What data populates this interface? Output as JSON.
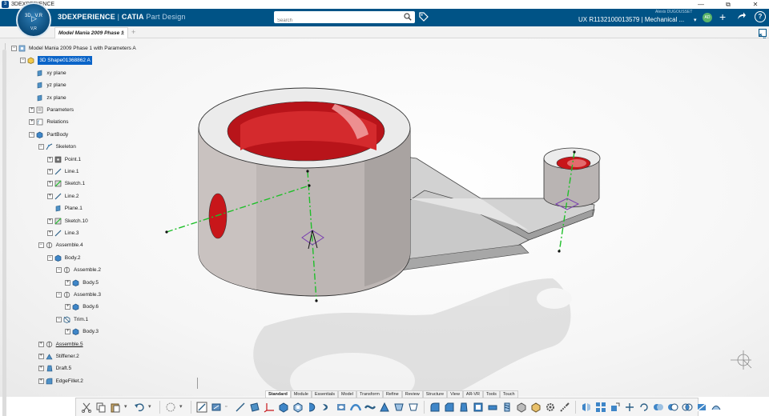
{
  "os": {
    "title": "3DEXPERIENCE",
    "controls": [
      "—",
      "⧉",
      "✕"
    ]
  },
  "app": {
    "compass_labels": {
      "top_left": "3D",
      "top_right": "V.R",
      "bottom": "V,R"
    },
    "brand_main": "3DEXPERIENCE",
    "brand_sep": " | ",
    "brand_app": "CATIA",
    "brand_module": " Part Design",
    "search_placeholder": "Search",
    "user": "Alexis DUGOUSSET",
    "context": "UX R1132100013579 | Mechanical ...",
    "context_caret": "▾",
    "avatar": "AD",
    "plus": "+",
    "help": "?"
  },
  "tabs": {
    "active": "Model Mania 2009 Phase 1",
    "close": "✕",
    "add": "+"
  },
  "tree": [
    {
      "label": "Model Mania 2009 Phase 1 with Parameters A",
      "indent": 0,
      "toggle": "−",
      "icon": "product-icon"
    },
    {
      "label": "3D Shape01368862 A",
      "indent": 1,
      "toggle": "−",
      "icon": "3d-shape-icon",
      "selected": true
    },
    {
      "label": "xy plane",
      "indent": 2,
      "toggle": "",
      "icon": "plane-icon"
    },
    {
      "label": "yz plane",
      "indent": 2,
      "toggle": "",
      "icon": "plane-icon"
    },
    {
      "label": "zx plane",
      "indent": 2,
      "toggle": "",
      "icon": "plane-icon"
    },
    {
      "label": "Parameters",
      "indent": 2,
      "toggle": "+",
      "icon": "parameters-icon"
    },
    {
      "label": "Relations",
      "indent": 2,
      "toggle": "+",
      "icon": "relations-icon"
    },
    {
      "label": "PartBody",
      "indent": 2,
      "toggle": "−",
      "icon": "body-icon"
    },
    {
      "label": "Skeleton",
      "indent": 3,
      "toggle": "−",
      "icon": "skeleton-icon"
    },
    {
      "label": "Point.1",
      "indent": 4,
      "toggle": "+",
      "icon": "point-icon"
    },
    {
      "label": "Line.1",
      "indent": 4,
      "toggle": "+",
      "icon": "line-icon"
    },
    {
      "label": "Sketch.1",
      "indent": 4,
      "toggle": "+",
      "icon": "sketch-icon"
    },
    {
      "label": "Line.2",
      "indent": 4,
      "toggle": "+",
      "icon": "line-icon"
    },
    {
      "label": "Plane.1",
      "indent": 4,
      "toggle": "",
      "icon": "plane-icon"
    },
    {
      "label": "Sketch.10",
      "indent": 4,
      "toggle": "+",
      "icon": "sketch-icon"
    },
    {
      "label": "Line.3",
      "indent": 4,
      "toggle": "+",
      "icon": "line-icon"
    },
    {
      "label": "Assemble.4",
      "indent": 3,
      "toggle": "−",
      "icon": "assemble-icon"
    },
    {
      "label": "Body.2",
      "indent": 4,
      "toggle": "−",
      "icon": "body-icon"
    },
    {
      "label": "Assemble.2",
      "indent": 5,
      "toggle": "−",
      "icon": "assemble-icon"
    },
    {
      "label": "Body.5",
      "indent": 6,
      "toggle": "+",
      "icon": "body-icon"
    },
    {
      "label": "Assemble.3",
      "indent": 5,
      "toggle": "−",
      "icon": "assemble-icon"
    },
    {
      "label": "Body.6",
      "indent": 6,
      "toggle": "+",
      "icon": "body-icon"
    },
    {
      "label": "Trim.1",
      "indent": 5,
      "toggle": "−",
      "icon": "trim-icon"
    },
    {
      "label": "Body.3",
      "indent": 6,
      "toggle": "+",
      "icon": "body-icon"
    },
    {
      "label": "Assemble.5",
      "indent": 3,
      "toggle": "+",
      "icon": "assemble-icon",
      "underline": true
    },
    {
      "label": "Stiffener.2",
      "indent": 3,
      "toggle": "+",
      "icon": "stiffener-icon"
    },
    {
      "label": "Draft.5",
      "indent": 3,
      "toggle": "+",
      "icon": "draft-icon"
    },
    {
      "label": "EdgeFillet.2",
      "indent": 3,
      "toggle": "+",
      "icon": "fillet-icon"
    }
  ],
  "section_tabs": [
    "Standard",
    "Module",
    "Essentials",
    "Model",
    "Transform",
    "Refine",
    "Review",
    "Structure",
    "View",
    "AR-VR",
    "Tools",
    "Touch"
  ],
  "active_section": "Standard",
  "colors": {
    "header": "#005386",
    "selection": "#0a64c8",
    "part_gray": "#bdb6b4",
    "hole_red": "#c8161a",
    "axis_green": "#1fbf2a",
    "plane_purple": "#7a3fb0"
  }
}
